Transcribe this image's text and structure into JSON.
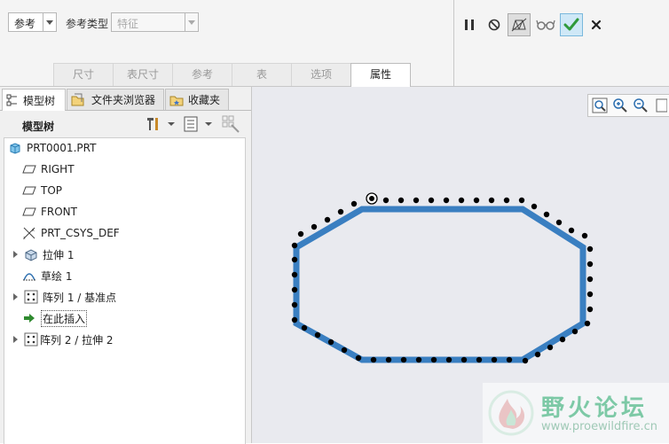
{
  "dashboard": {
    "reference_combo": "参考",
    "reference_type_label": "参考类型",
    "reference_type_value": "特征",
    "tabs": [
      {
        "label": "尺寸"
      },
      {
        "label": "表尺寸"
      },
      {
        "label": "参考"
      },
      {
        "label": "表"
      },
      {
        "label": "选项"
      },
      {
        "label": "属性"
      }
    ],
    "active_tab": "属性"
  },
  "panel": {
    "tabs": [
      {
        "label": "模型树"
      },
      {
        "label": "文件夹浏览器"
      },
      {
        "label": "收藏夹"
      }
    ],
    "tree_title": "模型树"
  },
  "tree": {
    "items": [
      {
        "label": "PRT0001.PRT",
        "icon": "part-icon"
      },
      {
        "label": "RIGHT",
        "icon": "datum-plane-icon"
      },
      {
        "label": "TOP",
        "icon": "datum-plane-icon"
      },
      {
        "label": "FRONT",
        "icon": "datum-plane-icon"
      },
      {
        "label": "PRT_CSYS_DEF",
        "icon": "csys-icon"
      },
      {
        "label": "拉伸 1",
        "icon": "extrude-icon"
      },
      {
        "label": "草绘 1",
        "icon": "sketch-icon"
      },
      {
        "label": "阵列 1 / 基准点",
        "icon": "pattern-icon"
      },
      {
        "label": "在此插入",
        "icon": "insert-arrow-icon"
      },
      {
        "label": "阵列 2 / 拉伸 2",
        "icon": "pattern-icon"
      }
    ]
  },
  "watermark": {
    "title": "野火论坛",
    "url": "www.proewildfire.cn"
  },
  "colors": {
    "accent_blue": "#3a7fc1",
    "ok_green": "#2f9a3a",
    "watermark_green": "#7dc9a6"
  }
}
